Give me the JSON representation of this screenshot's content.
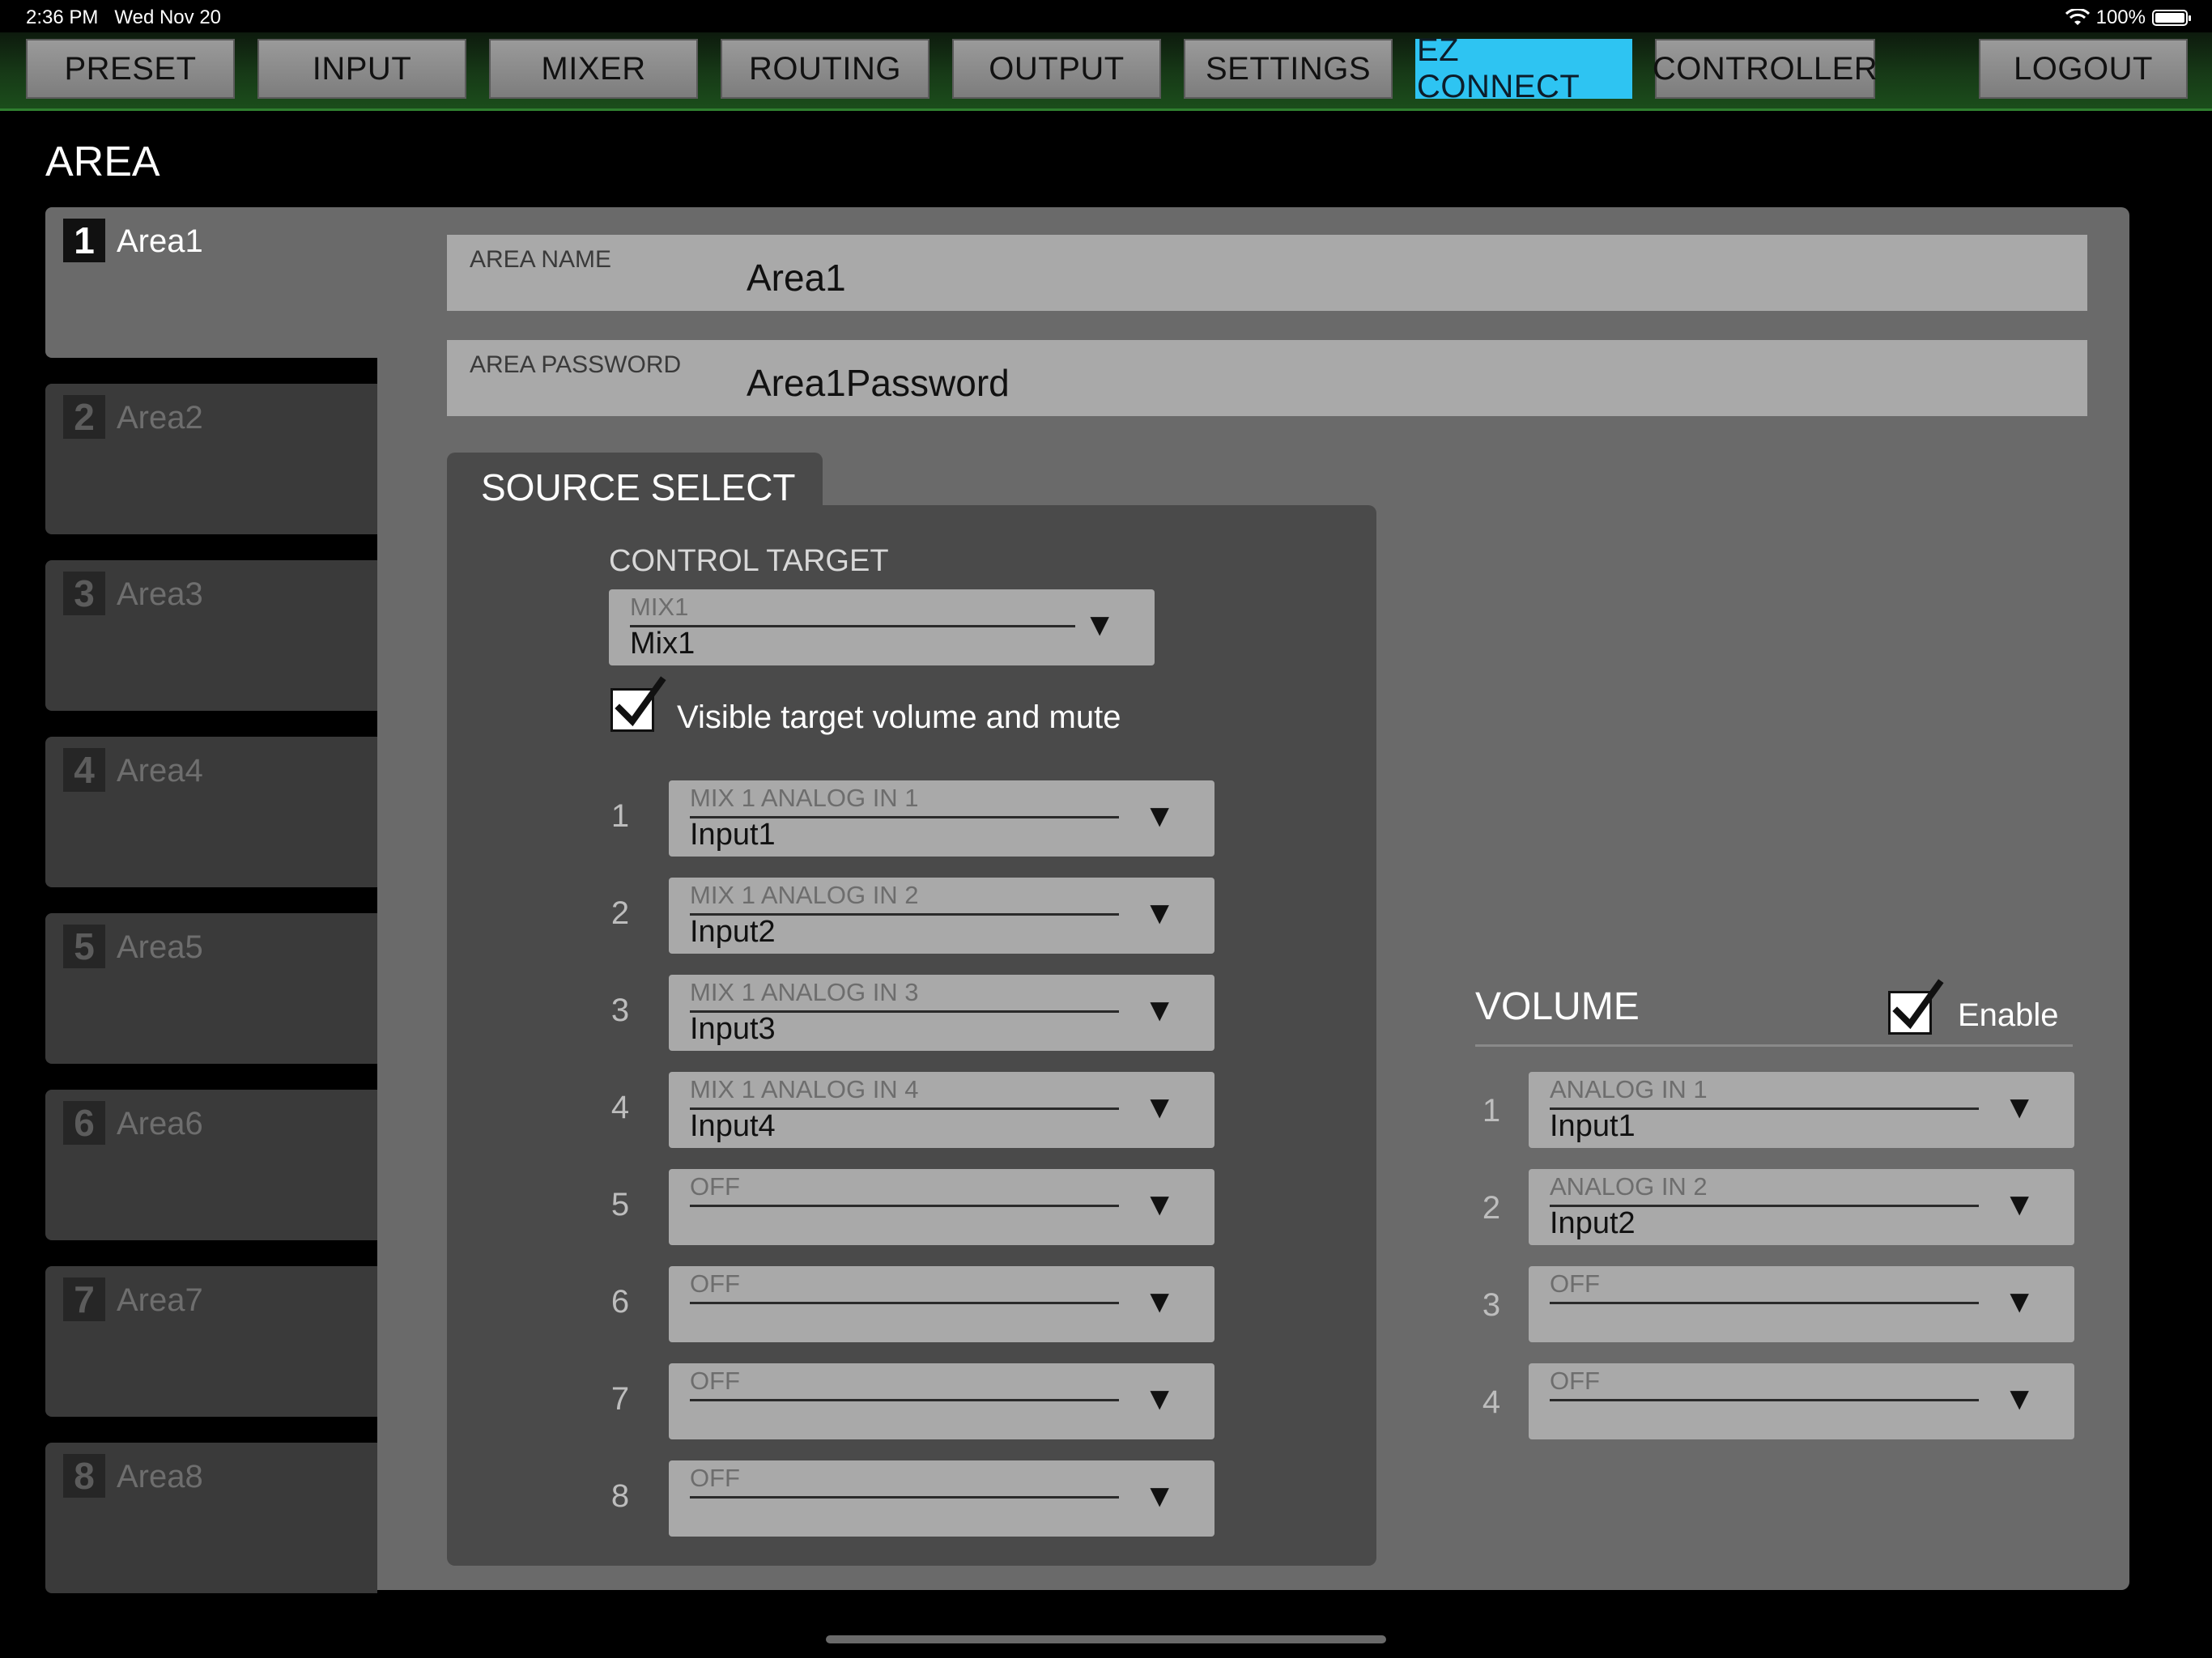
{
  "status_bar": {
    "time": "2:36 PM",
    "date": "Wed Nov 20",
    "battery": "100%"
  },
  "nav": {
    "tabs": [
      {
        "label": "PRESET"
      },
      {
        "label": "INPUT"
      },
      {
        "label": "MIXER"
      },
      {
        "label": "ROUTING"
      },
      {
        "label": "OUTPUT"
      },
      {
        "label": "SETTINGS"
      },
      {
        "label": "EZ CONNECT",
        "active": true
      },
      {
        "label": "CONTROLLER"
      }
    ],
    "logout": "LOGOUT",
    "accent_color": "#2ec4f2"
  },
  "page_title": "AREA",
  "areas": [
    {
      "num": "1",
      "label": "Area1",
      "selected": true
    },
    {
      "num": "2",
      "label": "Area2"
    },
    {
      "num": "3",
      "label": "Area3"
    },
    {
      "num": "4",
      "label": "Area4"
    },
    {
      "num": "5",
      "label": "Area5"
    },
    {
      "num": "6",
      "label": "Area6"
    },
    {
      "num": "7",
      "label": "Area7"
    },
    {
      "num": "8",
      "label": "Area8"
    }
  ],
  "area_name": {
    "label": "AREA NAME",
    "value": "Area1"
  },
  "area_password": {
    "label": "AREA PASSWORD",
    "value": "Area1Password"
  },
  "source_select": {
    "title": "SOURCE SELECT",
    "control_target_label": "CONTROL TARGET",
    "control_target": {
      "category": "MIX1",
      "value": "Mix1"
    },
    "visible_checkbox_label": "Visible target volume and mute",
    "visible_checked": true,
    "sources": [
      {
        "num": "1",
        "category": "MIX 1 ANALOG IN 1",
        "value": "Input1"
      },
      {
        "num": "2",
        "category": "MIX 1 ANALOG IN 2",
        "value": "Input2"
      },
      {
        "num": "3",
        "category": "MIX 1 ANALOG IN 3",
        "value": "Input3"
      },
      {
        "num": "4",
        "category": "MIX 1 ANALOG IN 4",
        "value": "Input4"
      },
      {
        "num": "5",
        "category": "OFF",
        "value": ""
      },
      {
        "num": "6",
        "category": "OFF",
        "value": ""
      },
      {
        "num": "7",
        "category": "OFF",
        "value": ""
      },
      {
        "num": "8",
        "category": "OFF",
        "value": ""
      }
    ]
  },
  "volume": {
    "title": "VOLUME",
    "enable_label": "Enable",
    "enabled": true,
    "items": [
      {
        "num": "1",
        "category": "ANALOG IN 1",
        "value": "Input1"
      },
      {
        "num": "2",
        "category": "ANALOG IN 2",
        "value": "Input2"
      },
      {
        "num": "3",
        "category": "OFF",
        "value": ""
      },
      {
        "num": "4",
        "category": "OFF",
        "value": ""
      }
    ]
  },
  "dropdown_arrow_glyph": "▼"
}
